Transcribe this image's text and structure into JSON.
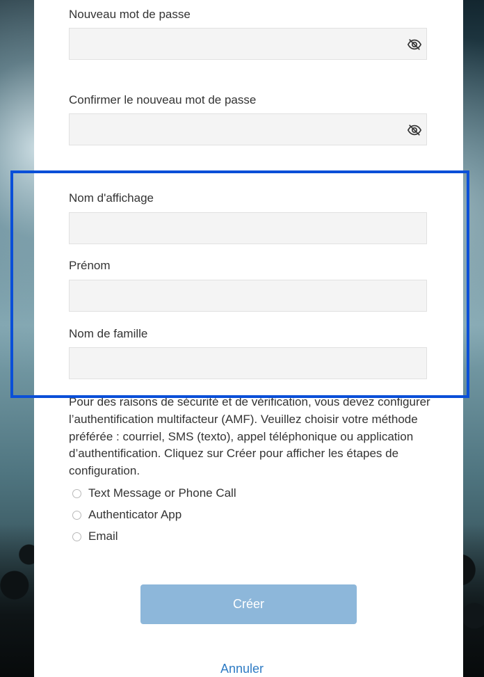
{
  "form": {
    "new_password": {
      "label": "Nouveau mot de passe",
      "value": "",
      "icon": "eye-slash-icon"
    },
    "confirm_password": {
      "label": "Confirmer le nouveau mot de passe",
      "value": "",
      "icon": "eye-slash-icon"
    },
    "display_name": {
      "label": "Nom d'affichage",
      "value": ""
    },
    "first_name": {
      "label": "Prénom",
      "value": ""
    },
    "last_name": {
      "label": "Nom de famille",
      "value": ""
    }
  },
  "mfa": {
    "description": "Pour des raisons de sécurité et de vérification, vous devez configurer l’authentification multifacteur (AMF). Veuillez choisir votre méthode préférée : courriel, SMS (texto), appel téléphonique ou application d’authentification. Cliquez sur Créer pour afficher les étapes de configuration.",
    "options": [
      {
        "label": "Text Message or Phone Call",
        "selected": false
      },
      {
        "label": "Authenticator App",
        "selected": false
      },
      {
        "label": "Email",
        "selected": false
      }
    ]
  },
  "actions": {
    "create_label": "Créer",
    "cancel_label": "Annuler"
  },
  "colors": {
    "highlight_border": "#0a4fd8",
    "create_button": "#8db7da",
    "cancel_link": "#2e7bc4"
  }
}
